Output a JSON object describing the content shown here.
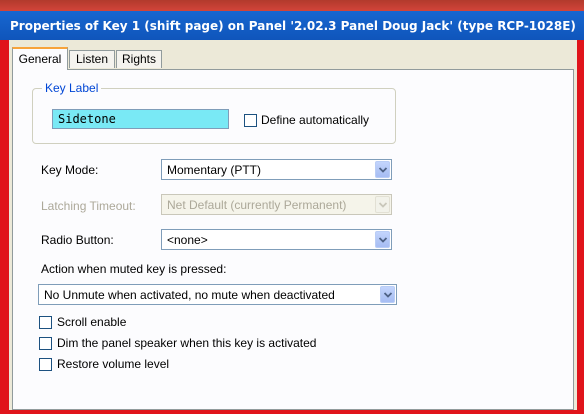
{
  "window": {
    "title": "Properties of Key 1 (shift page) on Panel '2.02.3 Panel Doug Jack' (type RCP-1028E)"
  },
  "tabs": [
    {
      "label": "General"
    },
    {
      "label": "Listen"
    },
    {
      "label": "Rights"
    }
  ],
  "key_label_group": {
    "legend": "Key Label",
    "value": "Sidetone",
    "define_auto_label": "Define automatically",
    "define_auto_checked": false
  },
  "key_mode": {
    "label": "Key Mode:",
    "selected": "Momentary (PTT)"
  },
  "latching_timeout": {
    "label": "Latching Timeout:",
    "selected": "Net Default (currently Permanent)",
    "disabled": true
  },
  "radio_button": {
    "label": "Radio Button:",
    "selected": "<none>"
  },
  "muted_action": {
    "label": "Action when muted key is pressed:",
    "selected": "No Unmute when activated, no mute when deactivated"
  },
  "options": [
    {
      "label": "Scroll enable",
      "checked": false
    },
    {
      "label": "Dim the panel speaker when this key is activated",
      "checked": false
    },
    {
      "label": "Restore volume level",
      "checked": false
    }
  ],
  "colors": {
    "title_bar": "#1460c8",
    "highlight_frame": "#e0141b",
    "key_label_field": "#79e9f5",
    "group_legend": "#0046d5"
  }
}
